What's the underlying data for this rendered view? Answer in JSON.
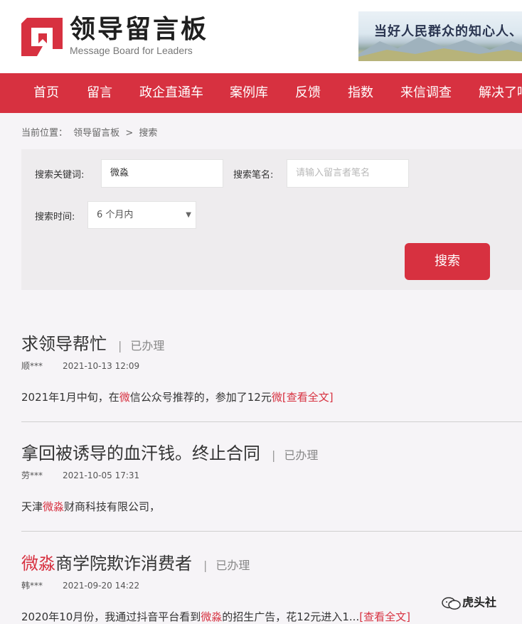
{
  "header": {
    "logo_title": "领导留言板",
    "logo_subtitle": "Message Board for Leaders",
    "banner_text": "当好人民群众的知心人、",
    "brand_color": "#d73140"
  },
  "nav": {
    "items": [
      "首页",
      "留言",
      "政企直通车",
      "案例库",
      "反馈",
      "指数",
      "来信调查",
      "解决了吗"
    ]
  },
  "breadcrumb": {
    "prefix": "当前位置：",
    "home": "领导留言板",
    "sep": ">",
    "current": "搜索"
  },
  "search": {
    "keyword_label": "搜索关键词:",
    "keyword_value": "微淼",
    "author_label": "搜索笔名:",
    "author_placeholder": "请输入留言者笔名",
    "time_label": "搜索时间:",
    "time_value": "6 个月内",
    "button_label": "搜索"
  },
  "results": [
    {
      "title_pre": "",
      "title_hl": "",
      "title_post": "求领导帮忙",
      "status_sep": "|",
      "status": "已办理",
      "author": "顺***",
      "date": "2021-10-13 12:09",
      "ex1": "2021年1月中旬，在",
      "ex_hl1": "微",
      "ex2": "信公众号推荐的，参加了12元",
      "ex_hl2": "微",
      "ex3": "",
      "more": "[查看全文]"
    },
    {
      "title_pre": "",
      "title_hl": "",
      "title_post": "拿回被诱导的血汗钱。终止合同",
      "status_sep": "|",
      "status": "已办理",
      "author": "劳***",
      "date": "2021-10-05 17:31",
      "ex1": "天津",
      "ex_hl1": "微淼",
      "ex2": "财商科技有限公司，",
      "ex_hl2": "",
      "ex3": "",
      "more": ""
    },
    {
      "title_pre": "",
      "title_hl": "微淼",
      "title_post": "商学院欺诈消费者",
      "status_sep": "|",
      "status": "已办理",
      "author": "韩***",
      "date": "2021-09-20 14:22",
      "ex1": "2020年10月份，我通过抖音平台看到",
      "ex_hl1": "微淼",
      "ex2": "的招生广告，花12元进入1...",
      "ex_hl2": "",
      "ex3": "",
      "more": "[查看全文]"
    }
  ],
  "watermark": {
    "text": "虎头社"
  }
}
